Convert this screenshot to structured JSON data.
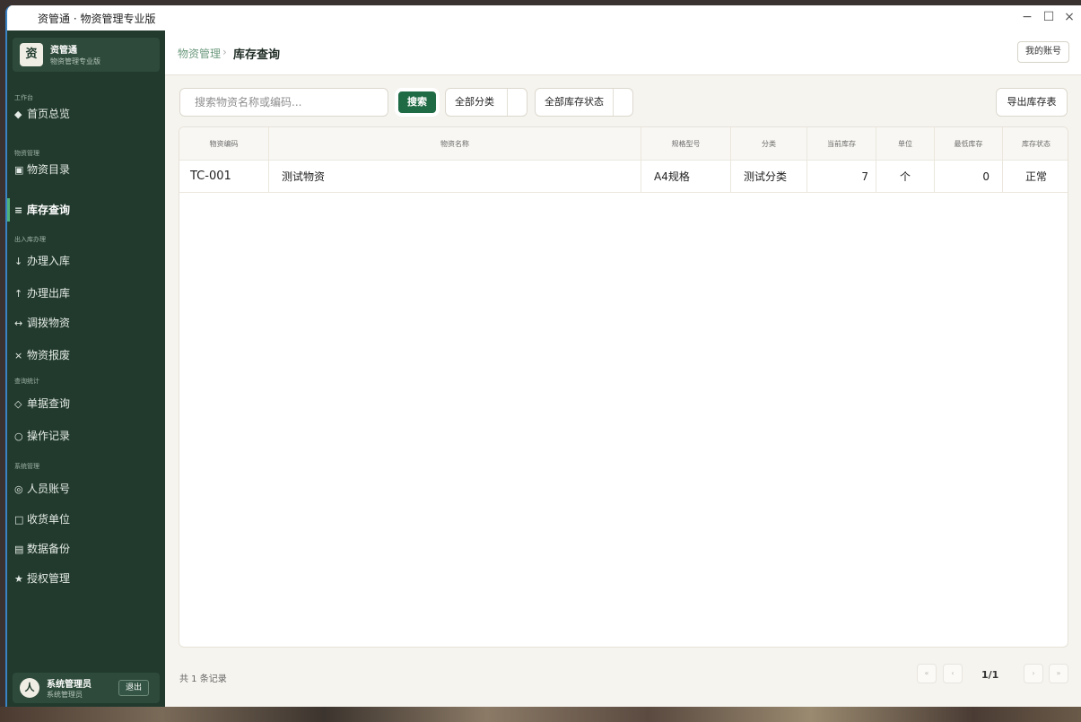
{
  "window": {
    "title": "资管通 · 物资管理专业版",
    "controls": {
      "minimize": "−",
      "maximize": "☐",
      "close": "×"
    }
  },
  "brand": {
    "logo": "资",
    "name": "资管通",
    "subtitle": "物资管理专业版"
  },
  "sidebar": {
    "groups": [
      {
        "label": "工作台"
      },
      {
        "label": "物资管理"
      },
      {
        "label": "出入库办理"
      },
      {
        "label": "查询统计"
      },
      {
        "label": "系统管理"
      }
    ],
    "items": [
      {
        "icon": "◆",
        "label": "首页总览"
      },
      {
        "icon": "▣",
        "label": "物资目录"
      },
      {
        "icon": "≡",
        "label": "库存查询"
      },
      {
        "icon": "↓",
        "label": "办理入库"
      },
      {
        "icon": "↑",
        "label": "办理出库"
      },
      {
        "icon": "↔",
        "label": "调拨物资"
      },
      {
        "icon": "×",
        "label": "物资报废"
      },
      {
        "icon": "◇",
        "label": "单据查询"
      },
      {
        "icon": "○",
        "label": "操作记录"
      },
      {
        "icon": "◎",
        "label": "人员账号"
      },
      {
        "icon": "□",
        "label": "收货单位"
      },
      {
        "icon": "▤",
        "label": "数据备份"
      },
      {
        "icon": "★",
        "label": "授权管理"
      }
    ],
    "active_item": "库存查询"
  },
  "user": {
    "avatar": "人",
    "name": "系统管理员",
    "role": "系统管理员",
    "logout_label": "退出"
  },
  "header": {
    "breadcrumb_parent": "物资管理",
    "breadcrumb_sep": "›",
    "breadcrumb_current": "库存查询",
    "account_label": "我的账号"
  },
  "toolbar": {
    "search_placeholder": "搜索物资名称或编码...",
    "search_value": "",
    "search_label": "搜索",
    "category_filter": "全部分类",
    "status_filter": "全部库存状态",
    "export_label": "导出库存表"
  },
  "table": {
    "columns": [
      "物资编码",
      "物资名称",
      "规格型号",
      "分类",
      "当前库存",
      "单位",
      "最低库存",
      "库存状态"
    ],
    "rows": [
      [
        "TC-001",
        "测试物资",
        "A4规格",
        "测试分类",
        "7",
        "个",
        "0",
        "正常"
      ]
    ]
  },
  "footer": {
    "record_count": "共 1 条记录",
    "first": "«",
    "prev": "‹",
    "page_info": "1/1",
    "next": "›",
    "last": "»"
  },
  "colors": {
    "sidebar_bg": "#223a2e",
    "accent_green": "#1f6b45",
    "page_bg": "#f6f4ef"
  }
}
